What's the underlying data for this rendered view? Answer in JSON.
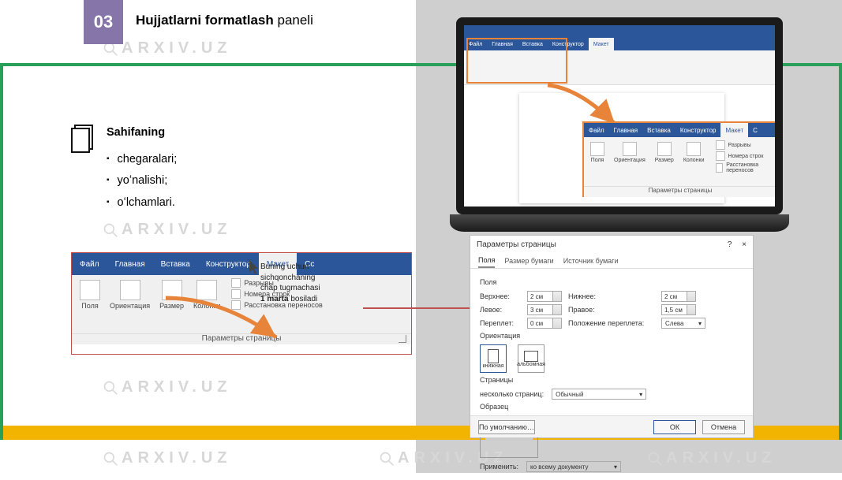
{
  "watermark": "ARXIV.UZ",
  "header": {
    "number": "03",
    "title_bold": "Hujjatlarni formatlash",
    "title_rest": " paneli"
  },
  "info": {
    "title": "Sahifaning",
    "items": [
      "chegaralari;",
      "yoʻnalishi;",
      "oʻlchamlari."
    ]
  },
  "ribbon": {
    "tabs": [
      "Файл",
      "Главная",
      "Вставка",
      "Конструктор",
      "Макет",
      "Сс"
    ],
    "selected_tab": "Макет",
    "group_caption": "Параметры страницы",
    "items": [
      "Поля",
      "Ориентация",
      "Размер",
      "Колонки"
    ],
    "right_items": [
      "Разрывы",
      "Номера строк",
      "Расстановка переносов"
    ]
  },
  "instruction": {
    "line1": "Buning uchun",
    "line2": "sichqonchaning",
    "line3": "chap tugmachasi",
    "line4_bold": "1 marta",
    "line4_rest": " bosiladi"
  },
  "laptop_callout": {
    "tabs": [
      "Файл",
      "Главная",
      "Вставка",
      "Конструктор",
      "Макет",
      "С"
    ],
    "selected_tab": "Макет",
    "body_items": [
      "Поля",
      "Ориентация",
      "Размер",
      "Колонки"
    ],
    "right_items": [
      "Разрывы",
      "Номера строк",
      "Расстановка переносов"
    ],
    "caption": "Параметры страницы"
  },
  "dialog": {
    "title": "Параметры страницы",
    "close": "×",
    "help": "?",
    "tabs": [
      "Поля",
      "Размер бумаги",
      "Источник бумаги"
    ],
    "selected_tab": "Поля",
    "sec_margins": "Поля",
    "fields": {
      "top_label": "Верхнее:",
      "top_val": "2 см",
      "bottom_label": "Нижнее:",
      "bottom_val": "2 см",
      "left_label": "Левое:",
      "left_val": "3 см",
      "right_label": "Правое:",
      "right_val": "1,5 см",
      "gutter_label": "Переплет:",
      "gutter_val": "0 см",
      "gutter_pos_label": "Положение переплета:",
      "gutter_pos_val": "Слева"
    },
    "sec_orient": "Ориентация",
    "orient_portrait": "книжная",
    "orient_landscape": "альбомная",
    "sec_pages": "Страницы",
    "pages_label": "несколько страниц:",
    "pages_val": "Обычный",
    "sec_preview": "Образец",
    "apply_label": "Применить:",
    "apply_val": "ко всему документу",
    "default_btn": "По умолчанию…",
    "ok_btn": "ОК",
    "cancel_btn": "Отмена"
  }
}
